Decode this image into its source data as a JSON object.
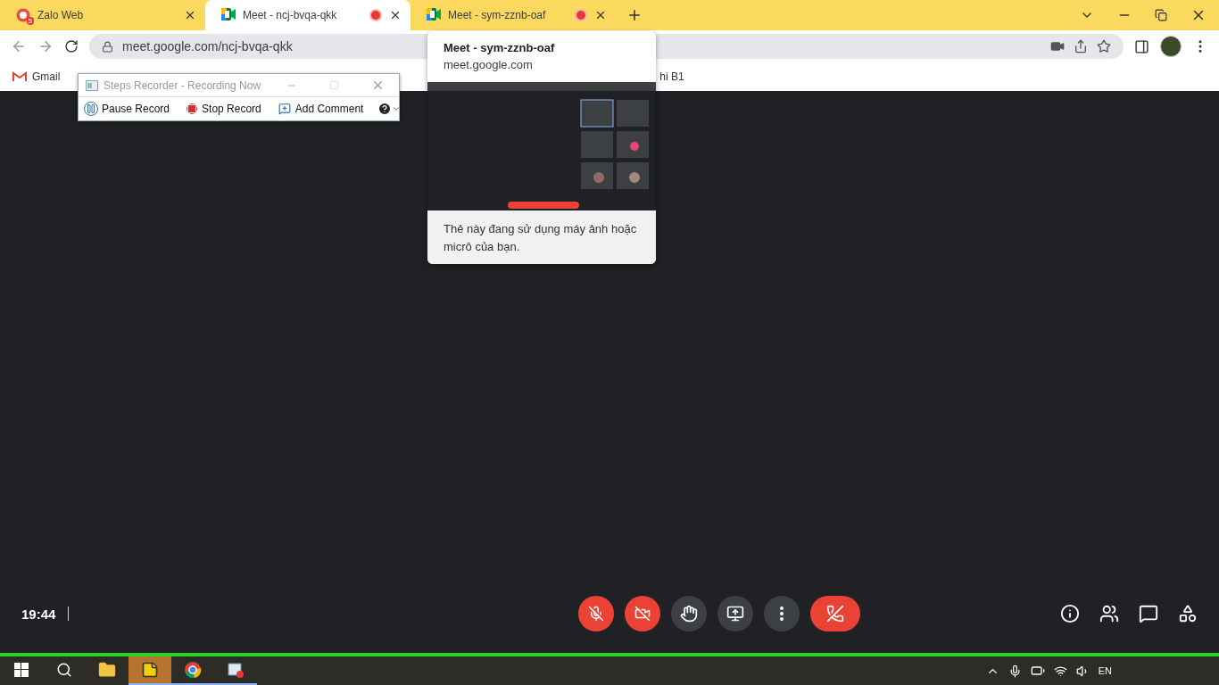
{
  "tabs": [
    {
      "kind": "zalo",
      "badge": "5",
      "title": "Zalo Web",
      "selected": false,
      "recording": false
    },
    {
      "kind": "meet",
      "title": "Meet - ncj-bvqa-qkk",
      "selected": true,
      "recording": true
    },
    {
      "kind": "meet",
      "title": "Meet - sym-zznb-oaf",
      "selected": false,
      "recording": true
    }
  ],
  "address": "meet.google.com/ncj-bvqa-qkk",
  "bookmarks": [
    {
      "kind": "gmail",
      "label": "Gmail"
    },
    {
      "kind": "plain",
      "label": "hi B1"
    }
  ],
  "hover_card": {
    "title": "Meet - sym-zznb-oaf",
    "url": "meet.google.com",
    "message": "Thẻ này đang sử dụng máy ảnh hoặc micrô của bạn."
  },
  "steps_recorder": {
    "title": "Steps Recorder - Recording Now",
    "buttons": [
      {
        "kind": "pause",
        "label": "Pause Record"
      },
      {
        "kind": "stop",
        "label": "Stop Record"
      },
      {
        "kind": "comment",
        "label": "Add Comment"
      }
    ]
  },
  "meeting": {
    "time": "19:44",
    "controls": [
      {
        "kind": "mic",
        "on": false
      },
      {
        "kind": "camera",
        "on": false
      },
      {
        "kind": "hand"
      },
      {
        "kind": "present"
      },
      {
        "kind": "more"
      },
      {
        "kind": "leave"
      }
    ],
    "side_controls": [
      {
        "kind": "info"
      },
      {
        "kind": "people"
      },
      {
        "kind": "chat"
      },
      {
        "kind": "activities"
      }
    ]
  },
  "taskbar": {
    "apps": [
      {
        "kind": "explorer",
        "running": false,
        "selected": false
      },
      {
        "kind": "notes",
        "running": true,
        "selected": true
      },
      {
        "kind": "chrome",
        "running": true,
        "selected": false
      },
      {
        "kind": "recorder",
        "running": true,
        "selected": false
      }
    ],
    "language": "EN"
  }
}
